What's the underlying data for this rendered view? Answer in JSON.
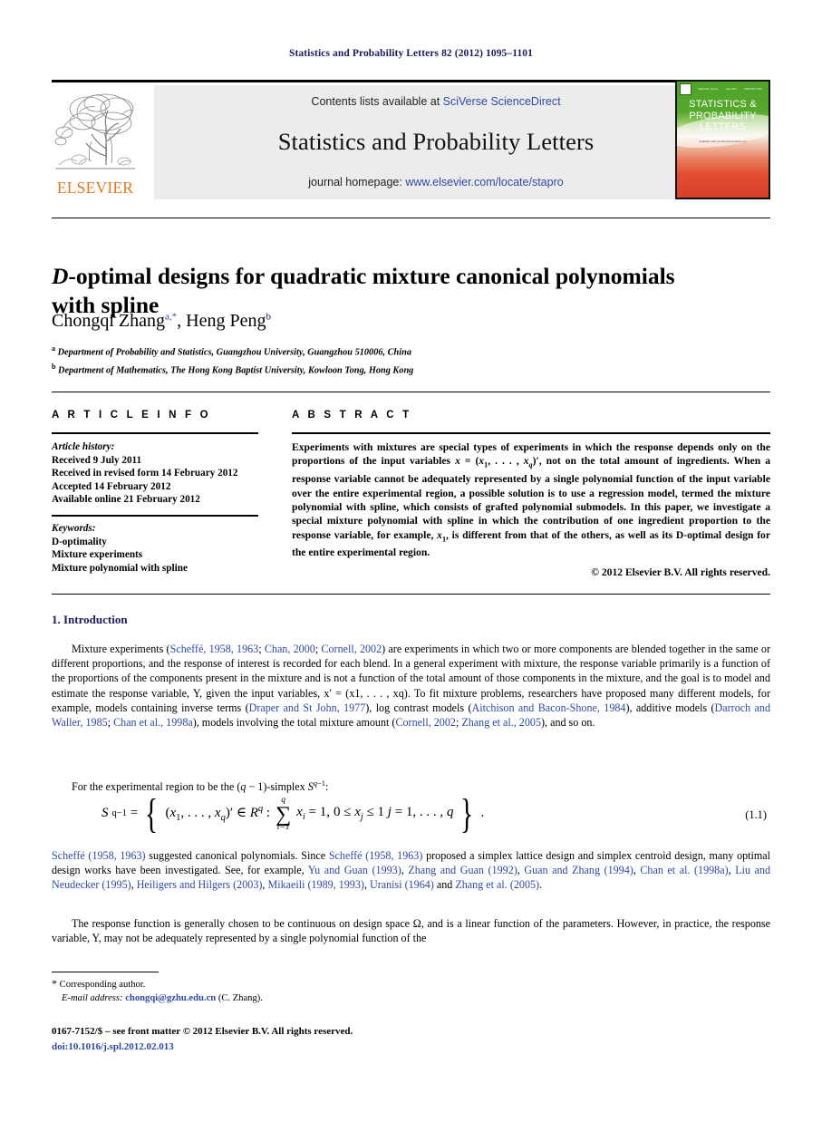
{
  "running_head": "Statistics and Probability Letters 82 (2012) 1095–1101",
  "masthead": {
    "contents_prefix": "Contents lists available at ",
    "contents_link": "SciVerse ScienceDirect",
    "journal_title": "Statistics and Probability Letters",
    "homepage_prefix": "journal homepage: ",
    "homepage_link": "www.elsevier.com/locate/stapro",
    "publisher": "ELSEVIER",
    "cover": {
      "title_line1": "STATISTICS &",
      "title_line2": "PROBABILITY",
      "title_line3": "LETTERS",
      "tiny1": "Volume 82, Issue 6",
      "tiny2": "June 2012",
      "tiny3": "ISSN 0167-7152",
      "caption": "Available online at www.sciencedirect.com"
    }
  },
  "title": {
    "italic_lead": "D",
    "rest_line1": "-optimal designs for quadratic mixture canonical polynomials",
    "line2": "with spline"
  },
  "authors": {
    "author1": "Chongqi Zhang",
    "author1_marks": "a,*",
    "separator": ", ",
    "author2": "Heng Peng",
    "author2_marks": "b"
  },
  "affiliations": [
    {
      "mark": "a",
      "text": "Department of Probability and Statistics, Guangzhou University, Guangzhou 510006, China"
    },
    {
      "mark": "b",
      "text": "Department of Mathematics, The Hong Kong Baptist University, Kowloon Tong, Hong Kong"
    }
  ],
  "article_info": {
    "heading": "A R T I C L E   I N F O",
    "history_label": "Article history:",
    "history": [
      "Received 9 July 2011",
      "Received in revised form 14 February 2012",
      "Accepted 14 February 2012",
      "Available online 21 February 2012"
    ],
    "keywords_label": "Keywords:",
    "keywords": [
      "D-optimality",
      "Mixture experiments",
      "Mixture polynomial with spline"
    ]
  },
  "abstract": {
    "heading": "A B S T R A C T",
    "part1": "Experiments with mixtures are special types of experiments in which the response depends only on the proportions of the input variables ",
    "math1": "x = (x1, . . . , xq)′",
    "part2": ", not on the total amount of ingredients. When a response variable cannot be adequately represented by a single polynomial function of the input variable over the entire experimental region, a possible solution is to use a regression model, termed the mixture polynomial with spline, which consists of grafted polynomial submodels. In this paper, we investigate a special mixture polynomial with spline in which the contribution of one ingredient proportion to the response variable, for example, ",
    "math2": "x1",
    "part3": ", is different from that of the others, as well as its D-optimal design for the entire experimental region.",
    "copyright": "© 2012 Elsevier B.V. All rights reserved."
  },
  "section1": {
    "number": "1.",
    "title": "Introduction"
  },
  "paragraphs": {
    "p1_a": "Mixture experiments (",
    "p1_cite1": "Scheffé, 1958, 1963",
    "p1_b": "; ",
    "p1_cite2": "Chan, 2000",
    "p1_c": "; ",
    "p1_cite3": "Cornell, 2002",
    "p1_d": ") are experiments in which two or more components are blended together in the same or different proportions, and the response of interest is recorded for each blend. In a general experiment with mixture, the response variable primarily is a function of the proportions of the components present in the mixture and is not a function of the total amount of those components in the mixture, and the goal is to model and estimate the response variable, Y, given the input variables, x′ = (x1, . . . , xq). To fit mixture problems, researchers have proposed many different models, for example, models containing inverse terms (",
    "p1_cite4": "Draper and St John, 1977",
    "p1_e": "), log contrast models (",
    "p1_cite5": "Aitchison and Bacon-Shone, 1984",
    "p1_f": "), additive models (",
    "p1_cite6": "Darroch and Waller, 1985",
    "p1_g": "; ",
    "p1_cite7": "Chan et al., 1998a",
    "p1_h": "), models involving the total mixture amount (",
    "p1_cite8": "Cornell, 2002",
    "p1_i": "; ",
    "p1_cite9": "Zhang et al., 2005",
    "p1_j": "), and so on.",
    "p2": "For the experimental region to be the (q − 1)-simplex Sq−1:",
    "p3_cite1": "Scheffé (1958, 1963)",
    "p3_a": " suggested canonical polynomials. Since ",
    "p3_cite2": "Scheffé (1958, 1963)",
    "p3_b": " proposed a simplex lattice design and simplex centroid design, many optimal design works have been investigated. See, for example, ",
    "p3_cite3": "Yu and Guan (1993)",
    "p3_c": ", ",
    "p3_cite4": "Zhang and Guan (1992)",
    "p3_d": ", ",
    "p3_cite5": "Guan and Zhang (1994)",
    "p3_e": ", ",
    "p3_cite6": "Chan et al. (1998a)",
    "p3_f": ", ",
    "p3_cite7": "Liu and Neudecker (1995)",
    "p3_g": ", ",
    "p3_cite8": "Heiligers and Hilgers (2003)",
    "p3_h": ", ",
    "p3_cite9": "Mikaeili (1989, 1993)",
    "p3_i": ", ",
    "p3_cite10": "Uranisi (1964)",
    "p3_j": " and ",
    "p3_cite11": "Zhang et al. (2005)",
    "p3_k": ".",
    "p4": "The response function is generally chosen to be continuous on design space Ω, and is a linear function of the parameters. However, in practice, the response variable, Y, may not be adequately represented by a single polynomial function of the"
  },
  "equation": {
    "number": "(1.1)",
    "lhs": "S",
    "lhs_sup": "q−1",
    "eq": "=",
    "set_open": "(x1, . . . , xq)′ ∈ R",
    "set_open_sup": "q",
    "colon": ":",
    "sigma_top": "q",
    "sigma_bottom": "i=1",
    "sum_body": "xi = 1,",
    "constraint": "0 ≤ xj ≤ 1 j = 1, . . . , q",
    "trailing": "."
  },
  "footnote": {
    "star": "*",
    "corresponding": "Corresponding author.",
    "email_label": "E-mail address:",
    "email": "chongqi@gzhu.edu.cn",
    "email_suffix": " (C. Zhang)."
  },
  "footer": {
    "issn": "0167-7152/$ – see front matter © 2012 Elsevier B.V. All rights reserved.",
    "doi": "doi:10.1016/j.spl.2012.02.013"
  }
}
